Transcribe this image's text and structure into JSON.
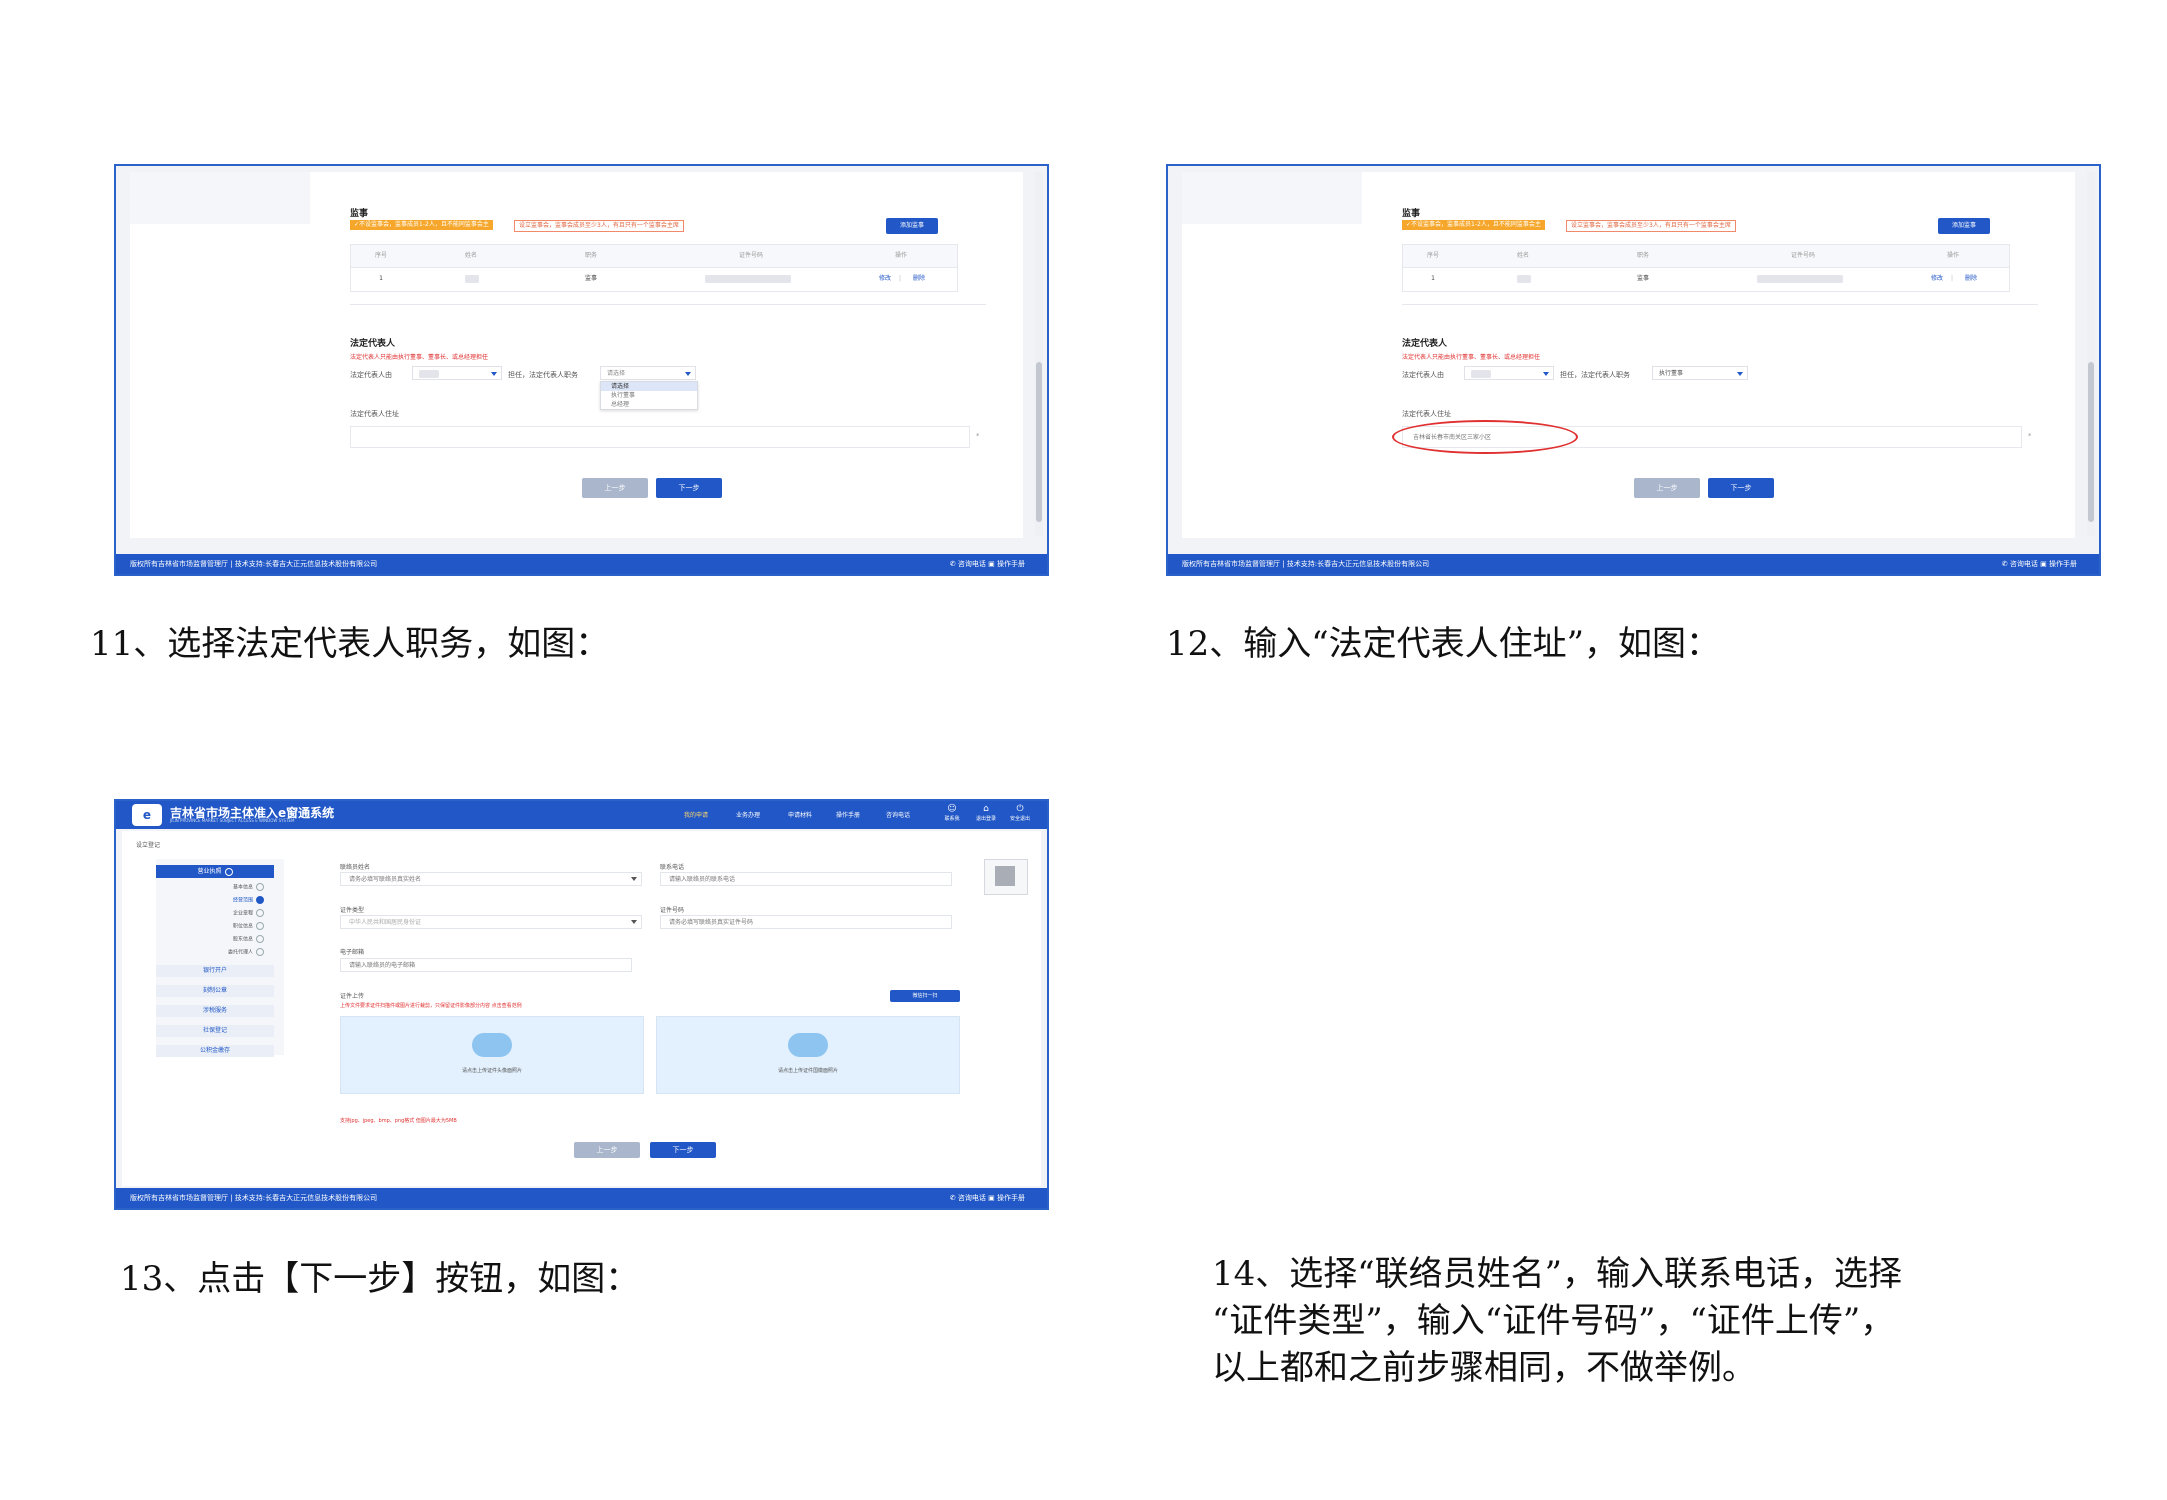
{
  "shot1": {
    "supervisor_title": "监事",
    "warn_yellow": "✓不设监事会，监事成员1-2人，且不能同监事会主",
    "warn_orange": "设立监事会，监事会成员至少3人，有且只有一个监事会主席",
    "add_supervisor_btn": "添加监事",
    "table_headers": [
      "序号",
      "姓名",
      "职务",
      "证件号码",
      "操作"
    ],
    "table_row": {
      "index": "1",
      "role": "监事",
      "edit": "修改",
      "delete": "删除"
    },
    "legal_title": "法定代表人",
    "legal_note": "法定代表人只能由执行董事、董事长、或总经理担任",
    "legal_from_label": "法定代表人由",
    "serve_label": "担任，法定代表人职务",
    "position_placeholder": "请选择",
    "dropdown_options": [
      "请选择",
      "执行董事",
      "总经理"
    ],
    "address_label": "法定代表人住址",
    "prev_btn": "上一步",
    "next_btn": "下一步"
  },
  "shot2": {
    "supervisor_title": "监事",
    "warn_yellow": "✓不设监事会，监事成员1-2人，且不能同监事会主",
    "warn_orange": "设立监事会，监事会成员至少3人，有且只有一个监事会主席",
    "add_supervisor_btn": "添加监事",
    "table_headers": [
      "序号",
      "姓名",
      "职务",
      "证件号码",
      "操作"
    ],
    "table_row": {
      "index": "1",
      "role": "监事",
      "edit": "修改",
      "delete": "删除"
    },
    "legal_title": "法定代表人",
    "legal_note": "法定代表人只能由执行董事、董事长、或总经理担任",
    "legal_from_label": "法定代表人由",
    "serve_label": "担任，法定代表人职务",
    "position_value": "执行董事",
    "address_label": "法定代表人住址",
    "address_value": "吉林省长春市南关区三家小区",
    "prev_btn": "上一步",
    "next_btn": "下一步"
  },
  "footer": {
    "left": "版权所有吉林省市场监督管理厅 | 技术支持:长春吉大正元信息技术股份有限公司",
    "right": "✆ 咨询电话 ▣ 操作手册"
  },
  "shot3": {
    "logo": "e",
    "app_title": "吉林省市场主体准入e窗通系统",
    "app_subtitle": "JILIN PROVINCE MARKET SUBJECT ACCESS E WINDOW SYSTEM",
    "nav": [
      "我的申请",
      "业务办理",
      "申请材料",
      "操作手册",
      "咨询电话"
    ],
    "top_icons": [
      "联系我",
      "退出登录",
      "安全退出"
    ],
    "breadcrumb": "设立登记",
    "side_main": "营业执照",
    "side_subs": [
      "基本信息",
      "经营范围",
      "企业章程",
      "职位信息",
      "股东信息",
      "委托代理人"
    ],
    "side_groups": [
      "银行开户",
      "刻制公章",
      "涉税服务",
      "社保登记",
      "公积金缴存"
    ],
    "contact_name_label": "联络员姓名",
    "contact_name_placeholder": "请务必填写联络员真实姓名",
    "phone_label": "联系电话",
    "phone_placeholder": "请输入联络员的联系电话",
    "id_type_label": "证件类型",
    "id_type_value": "中华人民共和国居民身份证",
    "id_no_label": "证件号码",
    "id_no_placeholder": "请务必填写联络员真实证件号码",
    "email_label": "电子邮箱",
    "email_placeholder": "请输入联络员的电子邮箱",
    "upload_label": "证件上传",
    "upload_note": "上传文件要求证件扫描件或图片进行裁剪，只保留证件影像部分内容 点击查看范例",
    "wx_btn": "微信扫一扫",
    "upload_front": "请点击上传证件头像面照片",
    "upload_back": "请点击上传证件国徽面照片",
    "format_note": "支持jpg、jpeg、bmp、png格式 但图片最大为5MB",
    "prev_btn": "上一步",
    "next_btn": "下一步"
  },
  "captions": {
    "c11": "11、选择法定代表人职务，如图：",
    "c12": "12、输入“法定代表人住址”，如图：",
    "c13": "13、点击【下一步】按钮，如图：",
    "c14_lines": [
      "14、选择“联络员姓名”，输入联系电话，选择",
      "“证件类型”，输入“证件号码”，“证件上传”，",
      "以上都和之前步骤相同，不做举例。"
    ]
  },
  "colors": {
    "brand": "#2157c6",
    "warn_yellow": "#f6a72b",
    "error_red": "#e03030"
  }
}
